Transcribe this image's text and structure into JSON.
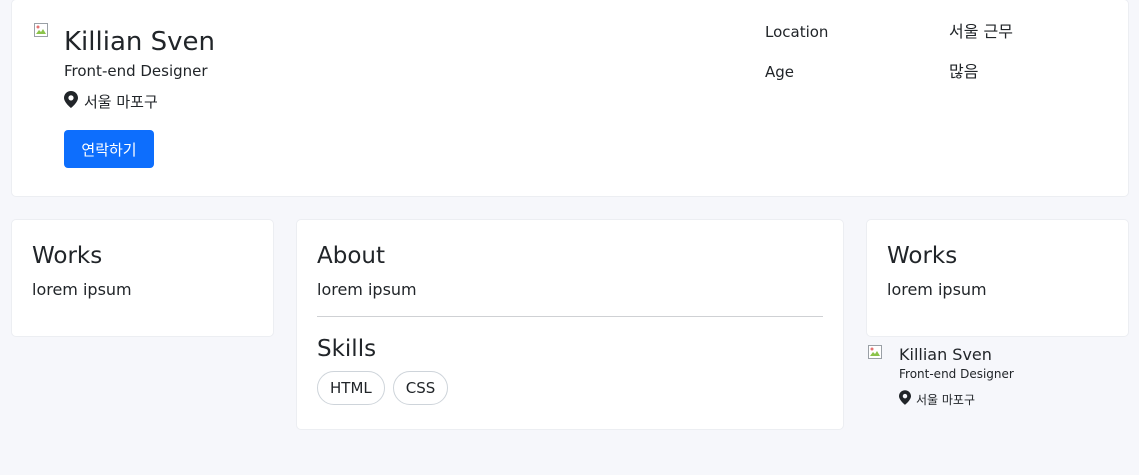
{
  "profile": {
    "name": "Killian Sven",
    "role": "Front-end Designer",
    "location": "서울 마포구",
    "contact_label": "연락하기",
    "accent_color": "#0d6efd",
    "details": [
      {
        "label": "Location",
        "value": "서울 근무"
      },
      {
        "label": "Age",
        "value": "많음"
      }
    ]
  },
  "left_card": {
    "title": "Works",
    "text": "lorem ipsum"
  },
  "center_card": {
    "title": "About",
    "text": "lorem ipsum",
    "skills_title": "Skills",
    "skills": [
      "HTML",
      "CSS"
    ]
  },
  "right_card": {
    "title": "Works",
    "text": "lorem ipsum"
  },
  "mini_profile": {
    "name": "Killian Sven",
    "role": "Front-end Designer",
    "location": "서울 마포구"
  },
  "icons": {
    "location": "map-pin-icon",
    "avatar": "broken-image-icon"
  }
}
